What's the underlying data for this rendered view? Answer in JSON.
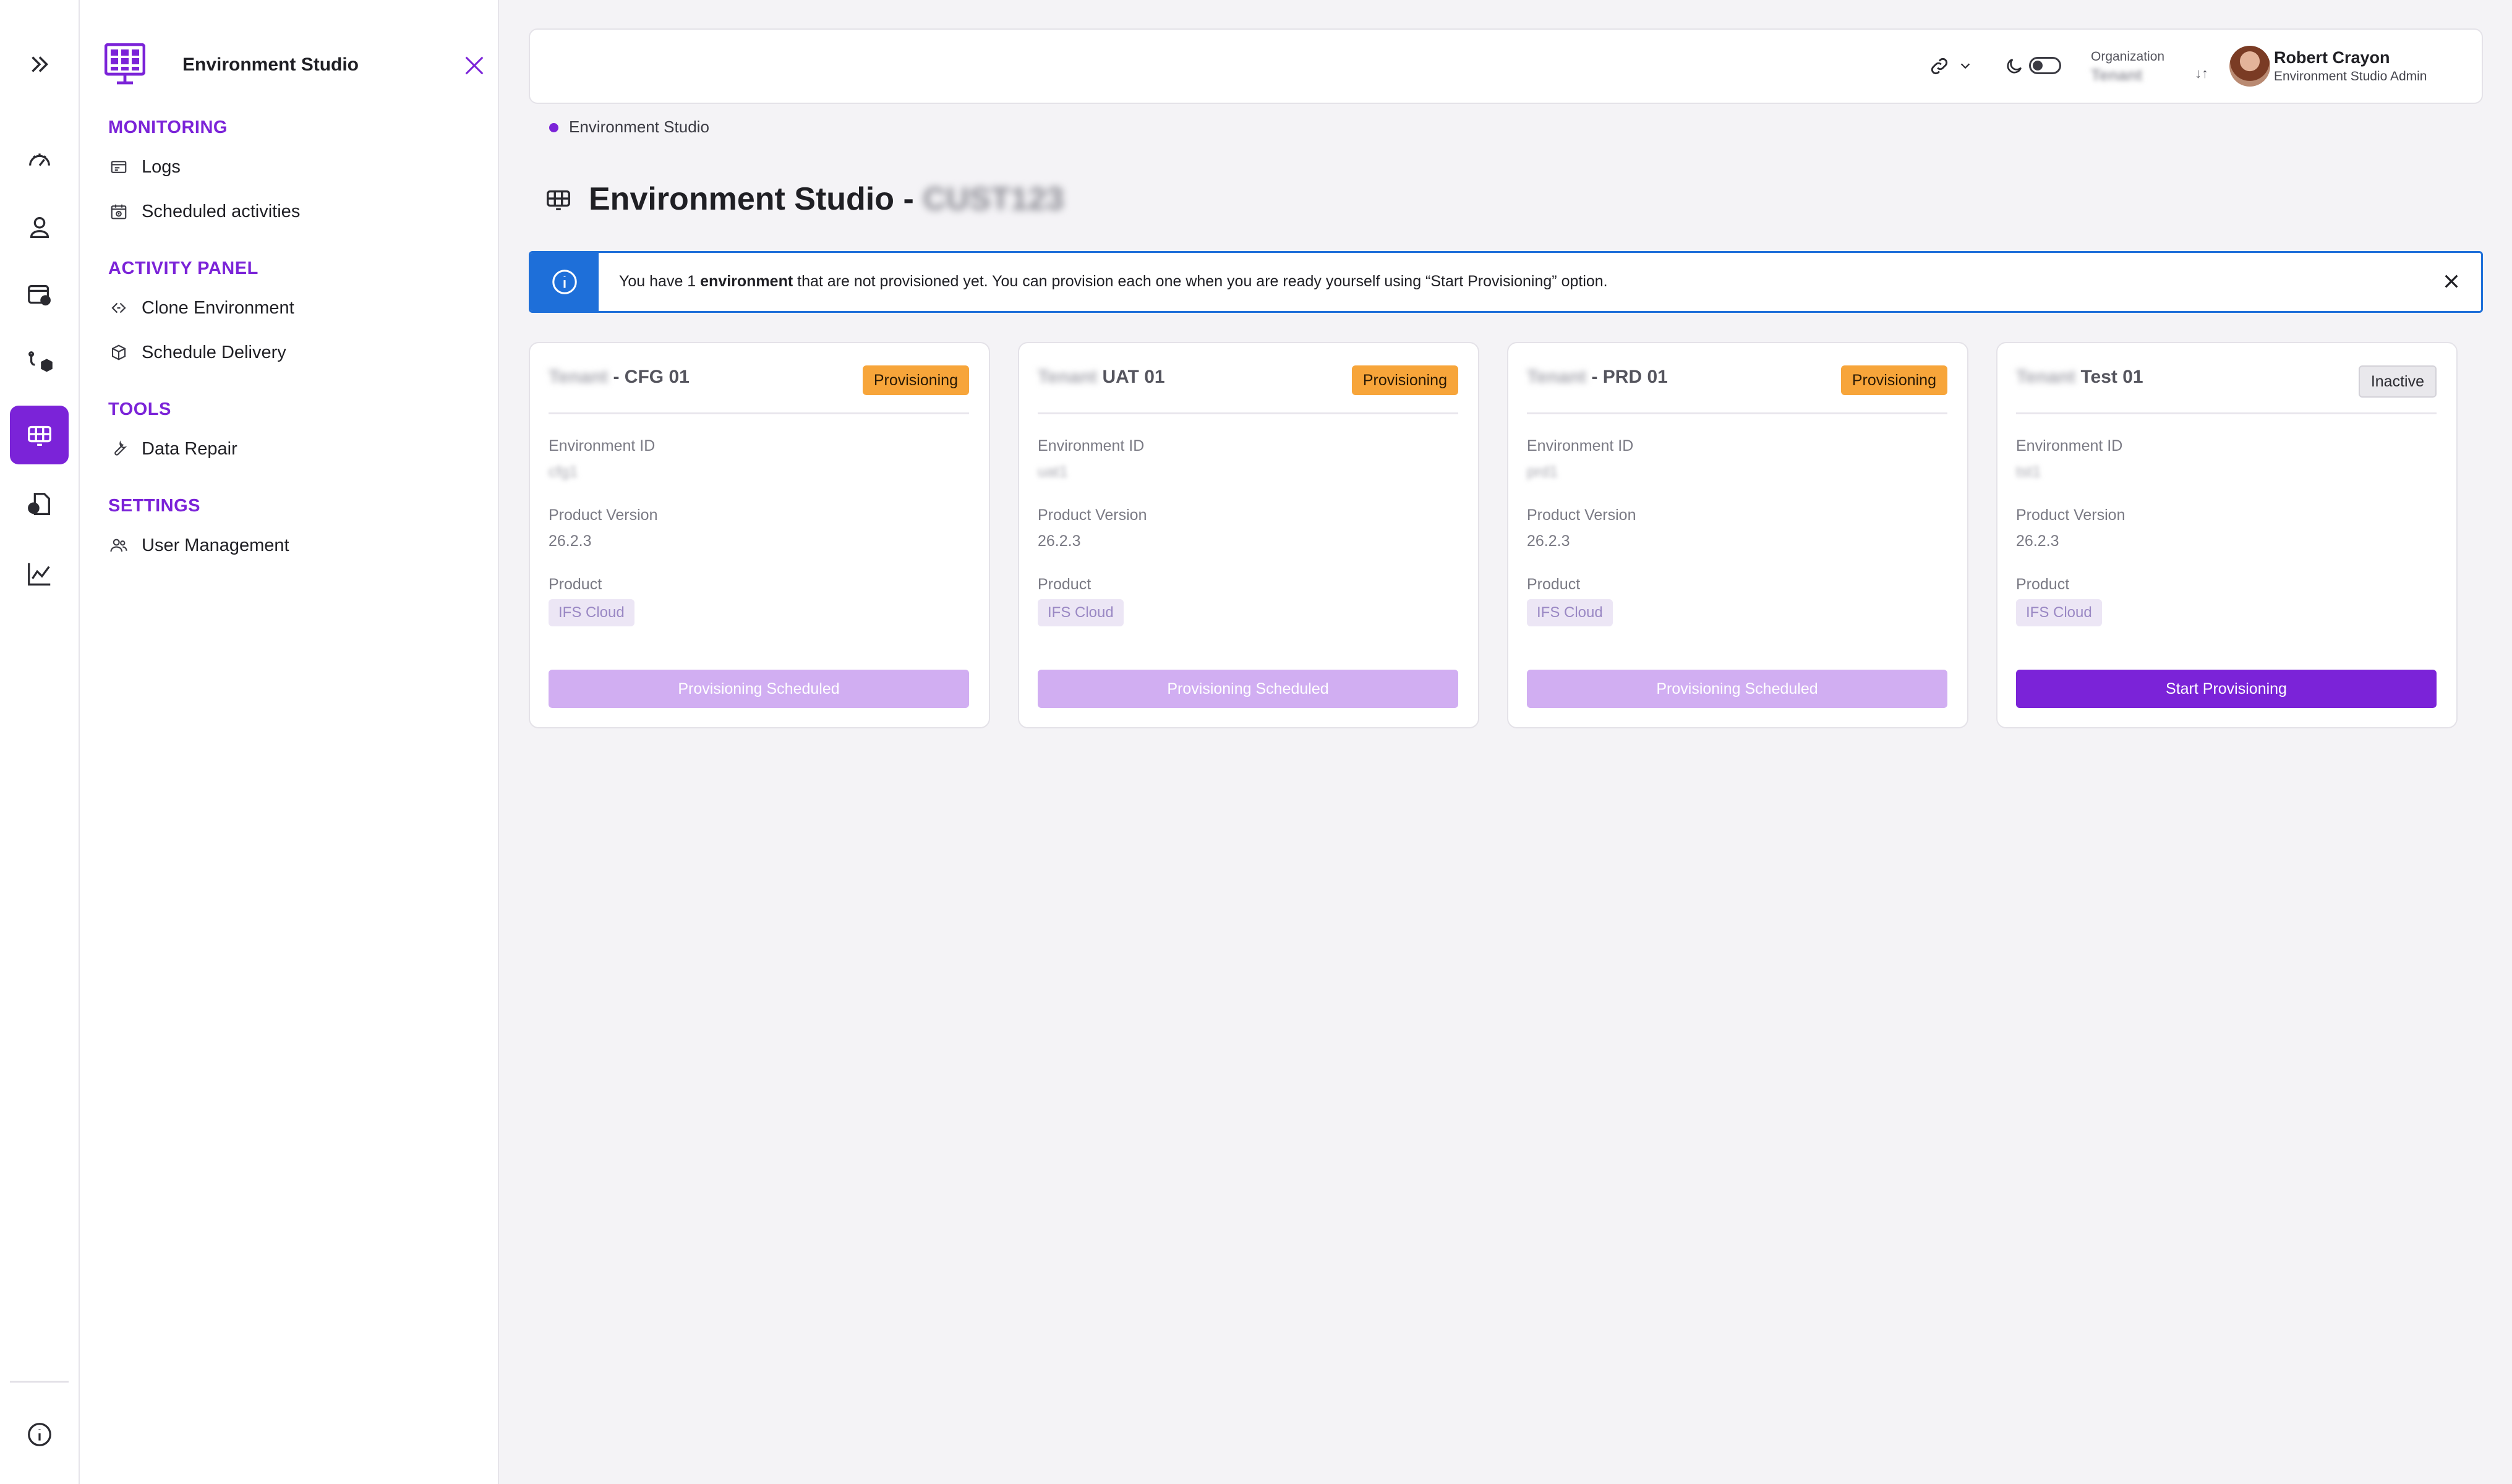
{
  "app": {
    "title": "Environment Studio",
    "accent_color": "#7b23d8",
    "info_color": "#1e6fd9",
    "warning_color": "#f7a53a"
  },
  "rail": {
    "items": [
      {
        "icon": "double-chevron-right-icon"
      },
      {
        "icon": "gauge-icon"
      },
      {
        "icon": "user-icon"
      },
      {
        "icon": "app-settings-icon"
      },
      {
        "icon": "network-cube-icon"
      },
      {
        "icon": "environment-grid-icon",
        "active": true
      },
      {
        "icon": "document-user-icon"
      },
      {
        "icon": "analytics-chart-icon"
      },
      {
        "icon": "info-icon"
      }
    ]
  },
  "nav": {
    "title": "Environment Studio",
    "sections": [
      {
        "label": "MONITORING",
        "items": [
          {
            "label": "Logs",
            "icon": "logs-icon"
          },
          {
            "label": "Scheduled activities",
            "icon": "calendar-clock-icon"
          }
        ]
      },
      {
        "label": "ACTIVITY PANEL",
        "items": [
          {
            "label": "Clone Environment",
            "icon": "clone-icon"
          },
          {
            "label": "Schedule Delivery",
            "icon": "package-icon"
          }
        ]
      },
      {
        "label": "TOOLS",
        "items": [
          {
            "label": "Data Repair",
            "icon": "wrench-icon"
          }
        ]
      },
      {
        "label": "SETTINGS",
        "items": [
          {
            "label": "User Management",
            "icon": "users-icon"
          }
        ]
      }
    ]
  },
  "topbar": {
    "org_label": "Organization",
    "org_name": "Tenant",
    "org_switch": "↓↑",
    "user_name": "Robert Crayon",
    "user_role": "Environment Studio Admin"
  },
  "breadcrumb": "Environment Studio",
  "page": {
    "title": "Environment Studio -",
    "customer": "CUST123"
  },
  "banner": {
    "text_before": "You have 1 ",
    "text_bold": "environment",
    "text_after": " that are not provisioned yet. You can provision each one when you are ready yourself using “Start Provisioning” option."
  },
  "cards": [
    {
      "tenant": "Tenant",
      "name": "- CFG 01",
      "status": "Provisioning",
      "env_id_label": "Environment ID",
      "env_id": "cfg1",
      "version_label": "Product Version",
      "version": "26.2.3",
      "product_label": "Product",
      "product": "IFS Cloud",
      "button": "Provisioning Scheduled"
    },
    {
      "tenant": "Tenant",
      "name": "UAT 01",
      "status": "Provisioning",
      "env_id_label": "Environment ID",
      "env_id": "uat1",
      "version_label": "Product Version",
      "version": "26.2.3",
      "product_label": "Product",
      "product": "IFS Cloud",
      "button": "Provisioning Scheduled"
    },
    {
      "tenant": "Tenant",
      "name": "- PRD 01",
      "status": "Provisioning",
      "env_id_label": "Environment ID",
      "env_id": "prd1",
      "version_label": "Product Version",
      "version": "26.2.3",
      "product_label": "Product",
      "product": "IFS Cloud",
      "button": "Provisioning Scheduled"
    },
    {
      "tenant": "Tenant",
      "name": "Test 01",
      "status": "Inactive",
      "env_id_label": "Environment ID",
      "env_id": "tst1",
      "version_label": "Product Version",
      "version": "26.2.3",
      "product_label": "Product",
      "product": "IFS Cloud",
      "button": "Start Provisioning"
    }
  ]
}
